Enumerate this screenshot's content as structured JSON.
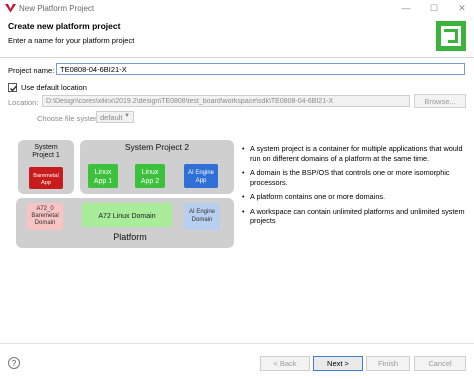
{
  "window": {
    "title": "New Platform Project"
  },
  "header": {
    "title": "Create new platform project",
    "subtitle": "Enter a name for your platform project"
  },
  "form": {
    "project_name_label": "Project name:",
    "project_name_value": "TE0808-04-6BI21-X",
    "use_default_label": "Use default location",
    "use_default_checked": true,
    "location_label": "Location:",
    "location_value": "D:\\Design\\cores\\xilinx\\2019.2\\design\\TE0808\\test_board\\workspace\\sdk\\TE0808-04-6BI21-X",
    "browse_label": "Browse...",
    "fs_label": "Choose file system:",
    "fs_value": "default"
  },
  "diagram": {
    "sp1": "System Project 1",
    "sp2": "System Project 2",
    "baremetal_app": "Baremetal App",
    "linux_app1": "Linux App 1",
    "linux_app2": "Linux App 2",
    "ai_app": "AI Engine App",
    "a72_baremetal": "A72_0 Baremetal Domain",
    "a72_linux": "A72 Linux Domain",
    "ai_domain": "AI Engine Domain",
    "platform": "Platform"
  },
  "info": {
    "bullets": [
      "A system project is a container for multiple applications that would run on different domains of a platform at the same time.",
      "A domain is the BSP/OS that controls one or more isomorphic processors.",
      "A platform contains one or more domains.",
      "A workspace can contain unlimited platforms and unlimited system projects"
    ]
  },
  "footer": {
    "help": "?",
    "back": "< Back",
    "next": "Next >",
    "finish": "Finish",
    "cancel": "Cancel"
  },
  "colors": {
    "accent": "#3c7fd6",
    "baremetal": "#c81c1c",
    "linux": "#3bc13b",
    "ai": "#2f6fd6",
    "domain_pink": "#f7c3c3",
    "domain_green": "#a9ec9a",
    "domain_blue": "#b8cff0"
  }
}
